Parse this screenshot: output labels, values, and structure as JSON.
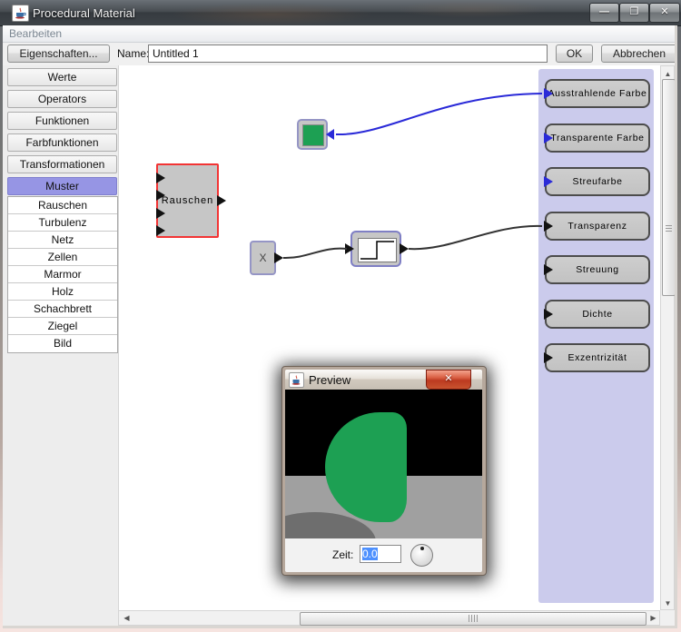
{
  "window": {
    "title": "Procedural Material",
    "minimize": "—",
    "maximize": "❐",
    "close": "✕"
  },
  "menu": {
    "edit": "Bearbeiten"
  },
  "toolbar": {
    "properties": "Eigenschaften...",
    "name_label": "Name:",
    "name_value": "Untitled 1",
    "ok": "OK",
    "cancel": "Abbrechen"
  },
  "sidebar": {
    "categories": [
      "Werte",
      "Operators",
      "Funktionen",
      "Farbfunktionen",
      "Transformationen",
      "Muster"
    ],
    "selected_category": "Muster",
    "patterns": [
      "Rauschen",
      "Turbulenz",
      "Netz",
      "Zellen",
      "Marmor",
      "Holz",
      "Schachbrett",
      "Ziegel",
      "Bild"
    ]
  },
  "graph": {
    "noise_node_label": "Rauschen",
    "multiply_node_label": "X",
    "outputs": [
      {
        "label": "Ausstrahlende Farbe",
        "arrow": "#2a2ad8"
      },
      {
        "label": "Transparente Farbe",
        "arrow": "#2a2ad8"
      },
      {
        "label": "Streufarbe",
        "arrow": "#2a2ad8"
      },
      {
        "label": "Transparenz",
        "arrow": "#111111"
      },
      {
        "label": "Streuung",
        "arrow": "#111111"
      },
      {
        "label": "Dichte",
        "arrow": "#111111"
      },
      {
        "label": "Exzentrizität",
        "arrow": "#111111"
      }
    ]
  },
  "preview": {
    "title": "Preview",
    "close": "✕",
    "time_label": "Zeit:",
    "time_value": "0.0"
  },
  "colors": {
    "swatch_green": "#1da053",
    "wire_blue": "#2a2ad8",
    "wire_black": "#333333",
    "selected_category_bg": "#9695e4",
    "output_panel_bg": "#cbcbec",
    "noise_border_red": "#f23434"
  }
}
